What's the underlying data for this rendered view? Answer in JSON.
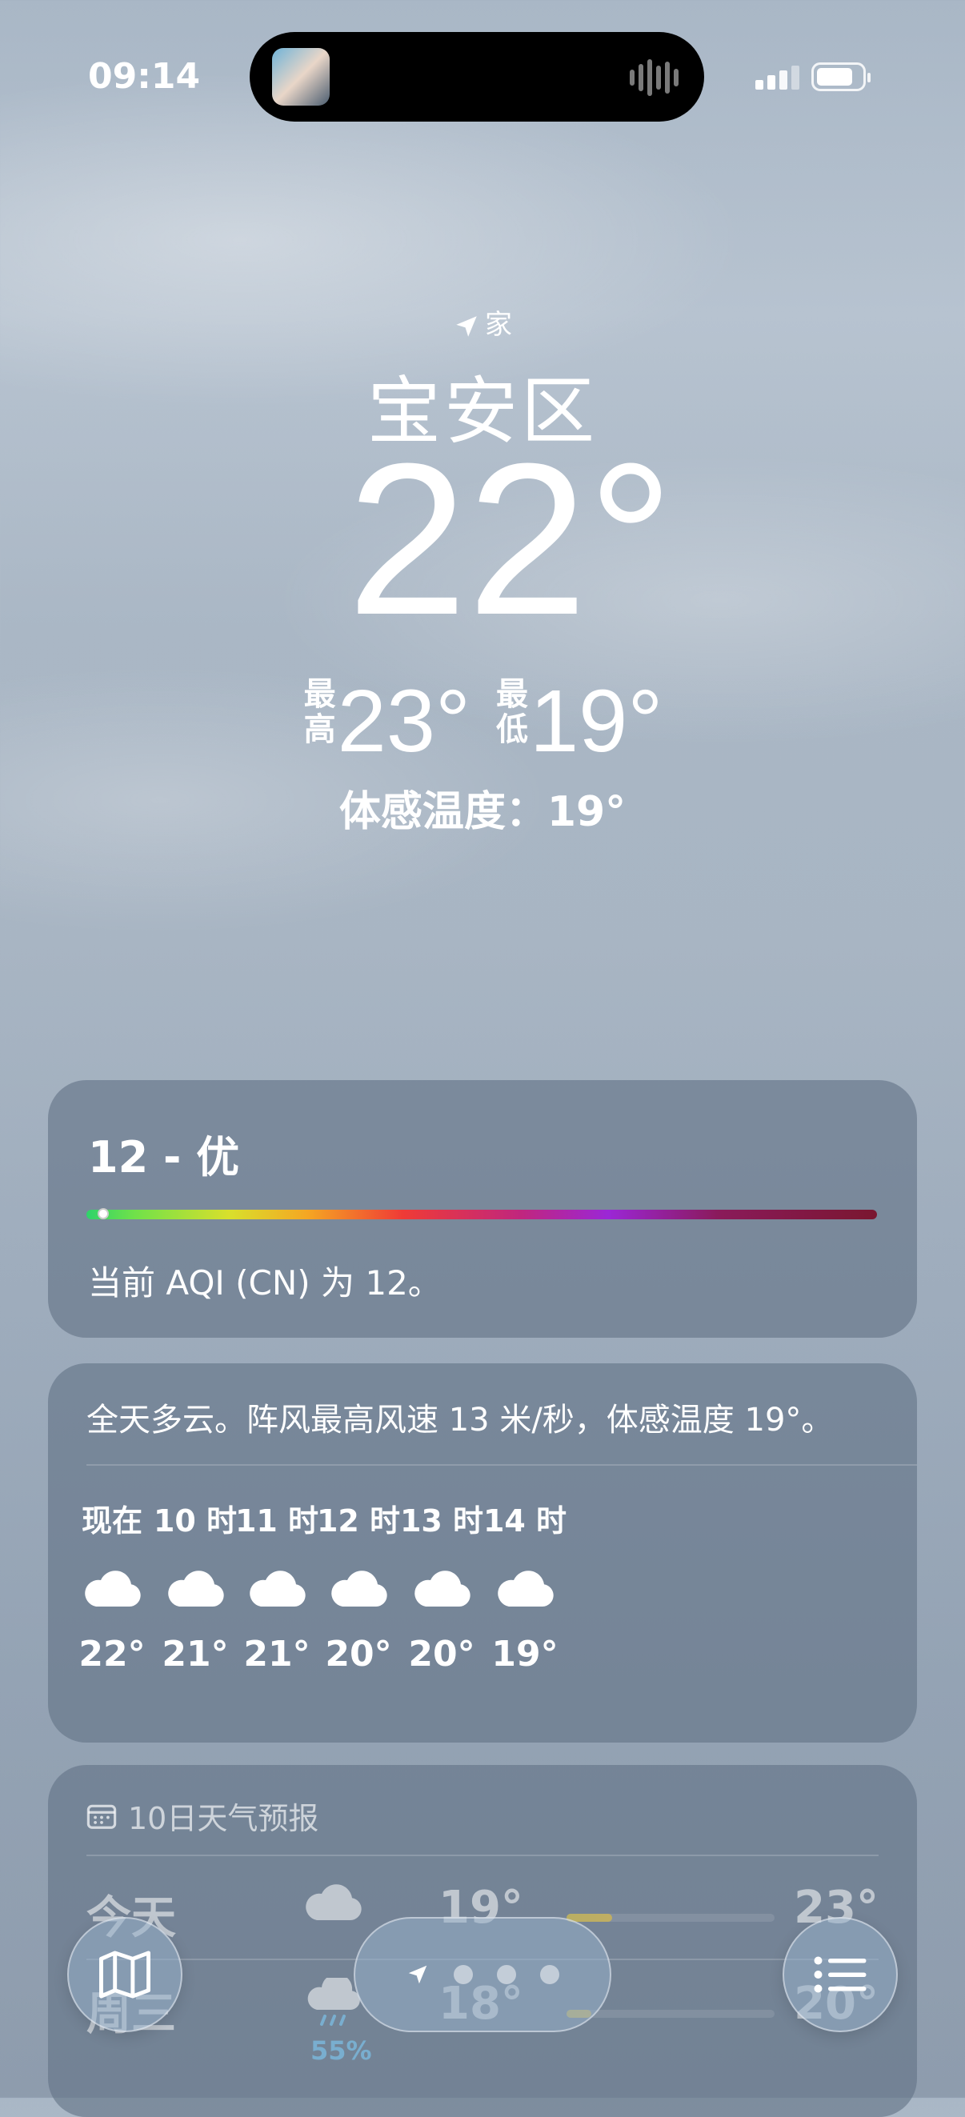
{
  "status_bar": {
    "time": "09:14"
  },
  "location": {
    "tag": "家",
    "name": "宝安区"
  },
  "current": {
    "temp": "22°",
    "high_label": "最高",
    "high": "23°",
    "low_label": "最低",
    "low": "19°",
    "feels_like": "体感温度：19°"
  },
  "aqi": {
    "value": "12 - 优",
    "level_fraction": 0.012,
    "description": "当前 AQI (CN) 为 12。"
  },
  "hourly": {
    "summary": "全天多云。阵风最高风速 13 米/秒，体感温度 19°。",
    "items": [
      {
        "time": "现在",
        "icon": "cloud-icon",
        "temp": "22°"
      },
      {
        "time": "10 时",
        "icon": "cloud-icon",
        "temp": "21°"
      },
      {
        "time": "11 时",
        "icon": "cloud-icon",
        "temp": "21°"
      },
      {
        "time": "12 时",
        "icon": "cloud-icon",
        "temp": "20°"
      },
      {
        "time": "13 时",
        "icon": "cloud-icon",
        "temp": "20°"
      },
      {
        "time": "14 时",
        "icon": "cloud-icon",
        "temp": "19°"
      }
    ]
  },
  "daily": {
    "header": "10日天气预报",
    "rows": [
      {
        "day": "今天",
        "icon": "cloud-icon",
        "precip": "",
        "low": "19°",
        "high": "23°"
      },
      {
        "day": "周三",
        "icon": "cloud-rain-icon",
        "precip": "55%",
        "low": "18°",
        "high": "20°"
      }
    ]
  },
  "colors": {
    "accent_precip": "#7fd2ff",
    "temp_bar": "#f2d23a"
  }
}
